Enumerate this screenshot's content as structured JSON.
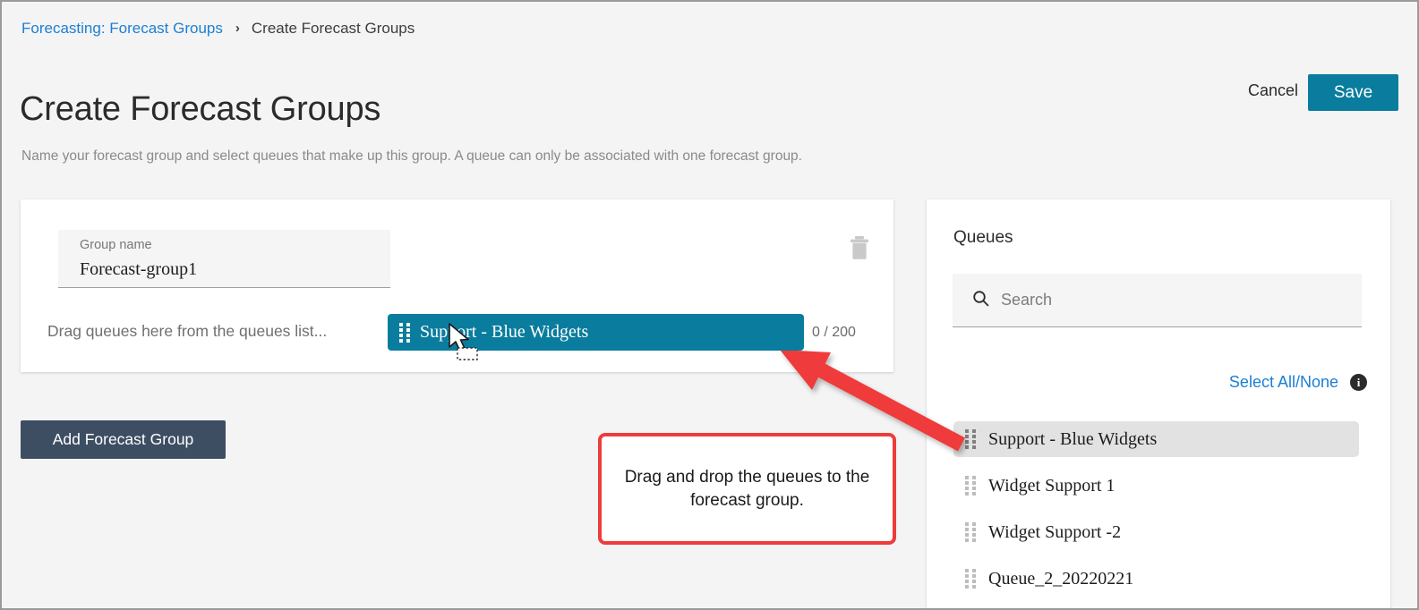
{
  "breadcrumb": {
    "parent": "Forecasting: Forecast Groups",
    "separator": "›",
    "current": "Create Forecast Groups"
  },
  "header": {
    "title": "Create Forecast Groups",
    "description": "Name your forecast group and select queues that make up this group. A queue can only be associated with one forecast group.",
    "cancel_label": "Cancel",
    "save_label": "Save"
  },
  "group_card": {
    "name_label": "Group name",
    "name_value": "Forecast-group1",
    "drop_hint": "Drag queues here from the queues list...",
    "counter": "0 / 200",
    "delete_icon": "trash-icon"
  },
  "drag_chip": {
    "label": "Support - Blue Widgets",
    "handle_icon": "drag-handle-icon"
  },
  "actions": {
    "add_group_label": "Add Forecast Group"
  },
  "callout": {
    "text": "Drag and drop the queues to the forecast group."
  },
  "queues": {
    "title": "Queues",
    "search_placeholder": "Search",
    "search_value": "",
    "search_icon": "search-icon",
    "select_all_label": "Select All/None",
    "info_icon": "info-icon",
    "info_glyph": "i",
    "items": [
      {
        "label": "Support - Blue Widgets",
        "selected": true
      },
      {
        "label": "Widget Support 1",
        "selected": false
      },
      {
        "label": "Widget Support -2",
        "selected": false
      },
      {
        "label": "Queue_2_20220221",
        "selected": false
      }
    ]
  },
  "colors": {
    "accent_teal": "#0a7d9e",
    "link_blue": "#1b7fd4",
    "dark_slate": "#3d4e63",
    "annotation_red": "#ef3b3b",
    "page_bg": "#f4f4f4"
  }
}
